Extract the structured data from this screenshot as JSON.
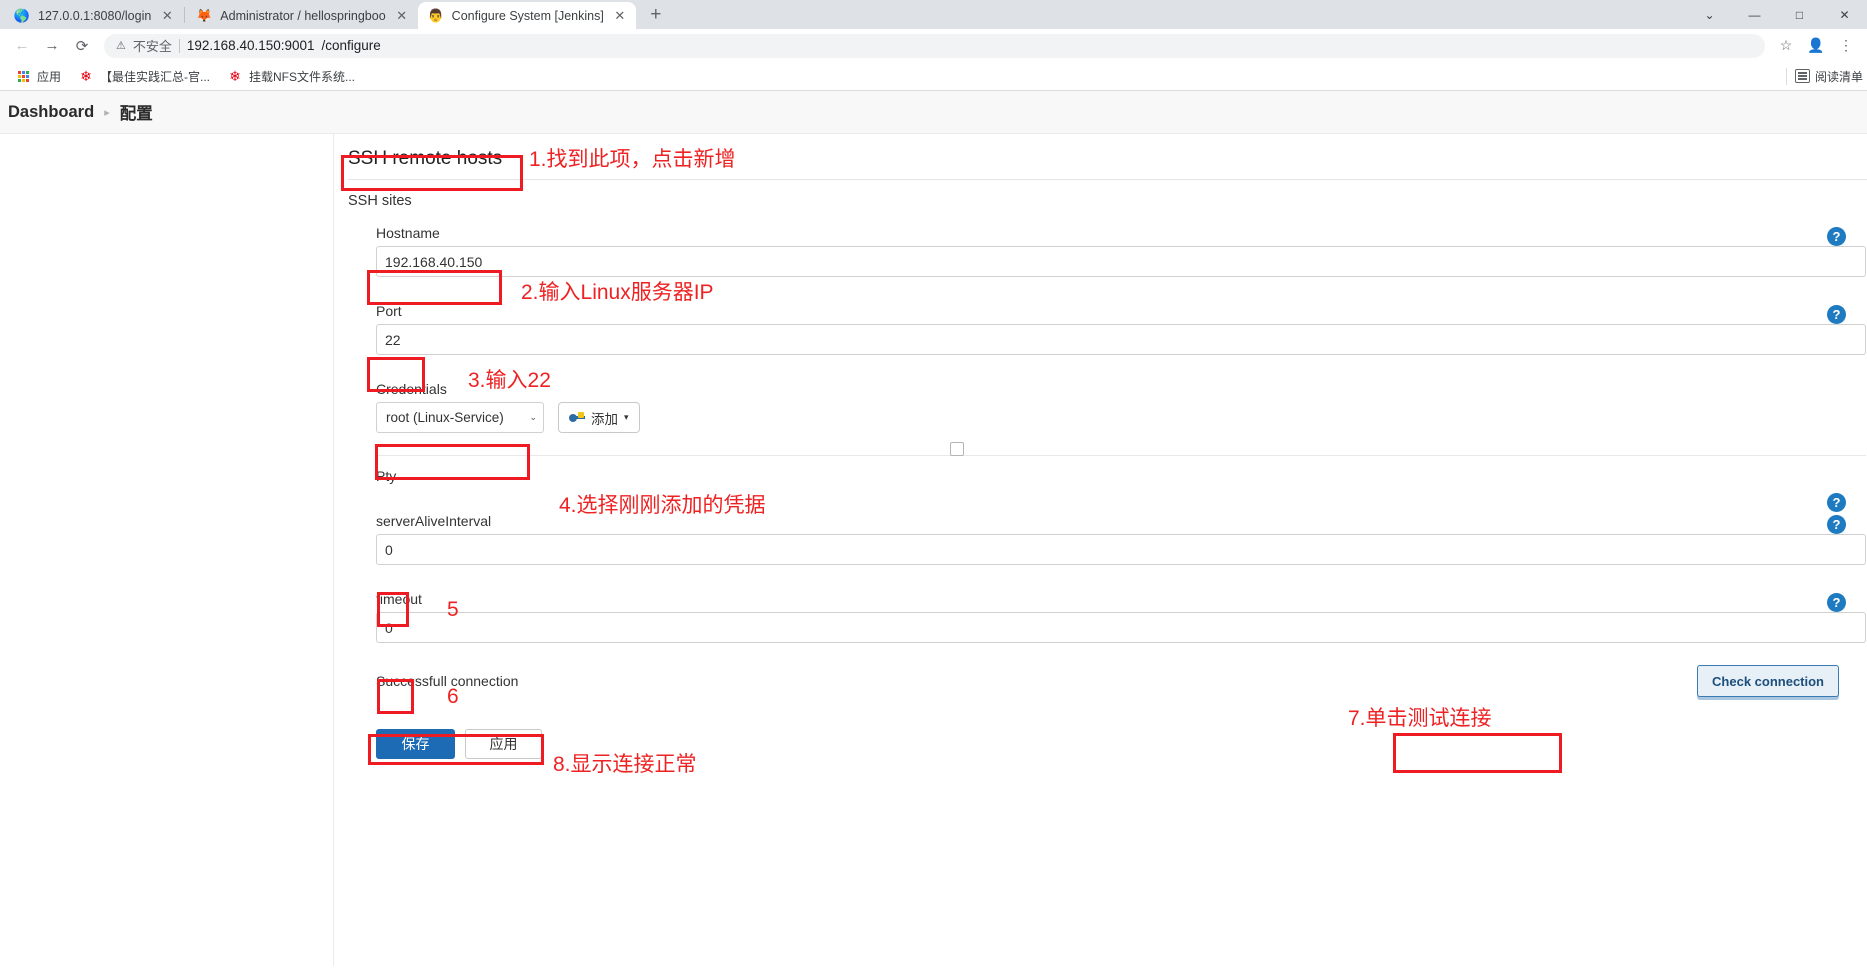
{
  "browser": {
    "tabs": [
      {
        "title": "127.0.0.1:8080/login",
        "favicon": "globe-icon",
        "active": false
      },
      {
        "title": "Administrator / hellospringboo",
        "favicon": "gitlab-icon",
        "active": false
      },
      {
        "title": "Configure System [Jenkins]",
        "favicon": "jenkins-icon",
        "active": true
      }
    ],
    "new_tab_label": "+",
    "window_controls": {
      "minimize": "—",
      "maximize": "□",
      "close": "✕",
      "chevron": "⌄"
    },
    "nav": {
      "back": "←",
      "forward": "→",
      "reload": "⟳"
    },
    "omnibox": {
      "security_icon": "⚠",
      "security_label": "不安全",
      "url_host": "192.168.40.150:9001",
      "url_path": "/configure",
      "star": "☆",
      "profile": "profile-icon",
      "menu": "⋮"
    },
    "bookmarks": [
      {
        "label": "应用",
        "icon": "apps-grid-icon"
      },
      {
        "label": "【最佳实践汇总-官...",
        "icon": "huawei-icon"
      },
      {
        "label": "挂载NFS文件系统...",
        "icon": "huawei-icon"
      }
    ],
    "reading_list": {
      "label": "阅读清单",
      "icon": "reading-list-icon"
    }
  },
  "page": {
    "breadcrumb": [
      {
        "label": "Dashboard"
      },
      {
        "label": "配置"
      }
    ],
    "breadcrumb_separator": "▸",
    "section": {
      "title": "SSH remote hosts",
      "subtitle": "SSH sites"
    },
    "fields": {
      "hostname": {
        "label": "Hostname",
        "value": "192.168.40.150",
        "help": "?"
      },
      "port": {
        "label": "Port",
        "value": "22",
        "help": "?"
      },
      "credentials": {
        "label": "Credentials",
        "selected": "root (Linux-Service)",
        "caret": "⌄",
        "add_button": "添加",
        "add_caret": "▾"
      },
      "pty": {
        "label": "Pty",
        "checked": false,
        "help": "?"
      },
      "server_alive_interval": {
        "label": "serverAliveInterval",
        "value": "0",
        "help": "?"
      },
      "timeout": {
        "label": "timeout",
        "value": "0",
        "help": "?"
      }
    },
    "connection": {
      "status": "Successfull connection",
      "check_button": "Check connection"
    },
    "footer": {
      "save": "保存",
      "apply": "应用"
    }
  },
  "annotations": {
    "color": "#ee2222",
    "items": [
      {
        "id": "a1",
        "text": "1.找到此项，点击新增"
      },
      {
        "id": "a2",
        "text": "2.输入Linux服务器IP"
      },
      {
        "id": "a3",
        "text": "3.输入22"
      },
      {
        "id": "a4",
        "text": "4.选择刚刚添加的凭据"
      },
      {
        "id": "a5",
        "text": "5"
      },
      {
        "id": "a6",
        "text": "6"
      },
      {
        "id": "a7",
        "text": "7.单击测试连接"
      },
      {
        "id": "a8",
        "text": "8.显示连接正常"
      }
    ]
  }
}
